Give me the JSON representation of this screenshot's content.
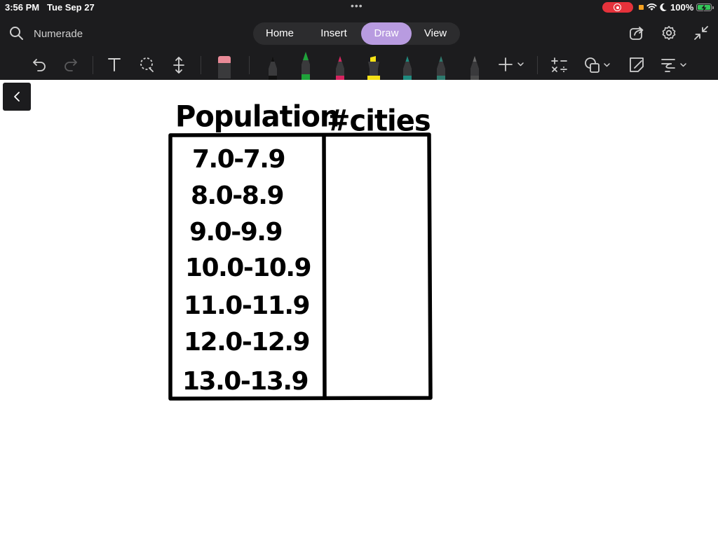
{
  "status_bar": {
    "time": "3:56 PM",
    "date": "Tue Sep 27",
    "multitask_dots": "•••",
    "battery_percent": "100%",
    "recording_color": "#e5323b",
    "battery_color": "#34c759"
  },
  "nav": {
    "app_name": "Numerade",
    "tabs": [
      {
        "label": "Home"
      },
      {
        "label": "Insert"
      },
      {
        "label": "Draw",
        "active": true
      },
      {
        "label": "View"
      }
    ],
    "right_icons": [
      "share-icon",
      "settings-icon",
      "collapse-icon"
    ],
    "accent": "#b89be0"
  },
  "toolbar": {
    "tools": [
      "undo-icon",
      "redo-icon",
      "text-tool-icon",
      "lasso-icon",
      "space-insert-icon",
      "eraser-icon",
      "pen-black-icon",
      "pen-green-icon",
      "pen-pink-icon",
      "highlighter-yellow-icon",
      "pen-teal-icon",
      "pen-teal-dark-icon",
      "pencil-gray-icon",
      "add-tool-icon",
      "math-icon",
      "shapes-icon",
      "sticky-note-icon",
      "line-style-icon"
    ],
    "pen_colors": {
      "black": "#2a2a2a",
      "green": "#1fa23a",
      "pink": "#d6245f",
      "yellow": "#f6e216",
      "teal": "#1f8a7f",
      "teal_dark": "#2e7a6e",
      "gray": "#4a4a4a"
    }
  },
  "canvas": {
    "table": {
      "headers": [
        "Population",
        "#cities"
      ],
      "rows": [
        {
          "range": "7.0-7.9",
          "cities": ""
        },
        {
          "range": "8.0-8.9",
          "cities": ""
        },
        {
          "range": "9.0-9.9",
          "cities": ""
        },
        {
          "range": "10.0-10.9",
          "cities": ""
        },
        {
          "range": "11.0-11.9",
          "cities": ""
        },
        {
          "range": "12.0-12.9",
          "cities": ""
        },
        {
          "range": "13.0-13.9",
          "cities": ""
        }
      ]
    }
  }
}
